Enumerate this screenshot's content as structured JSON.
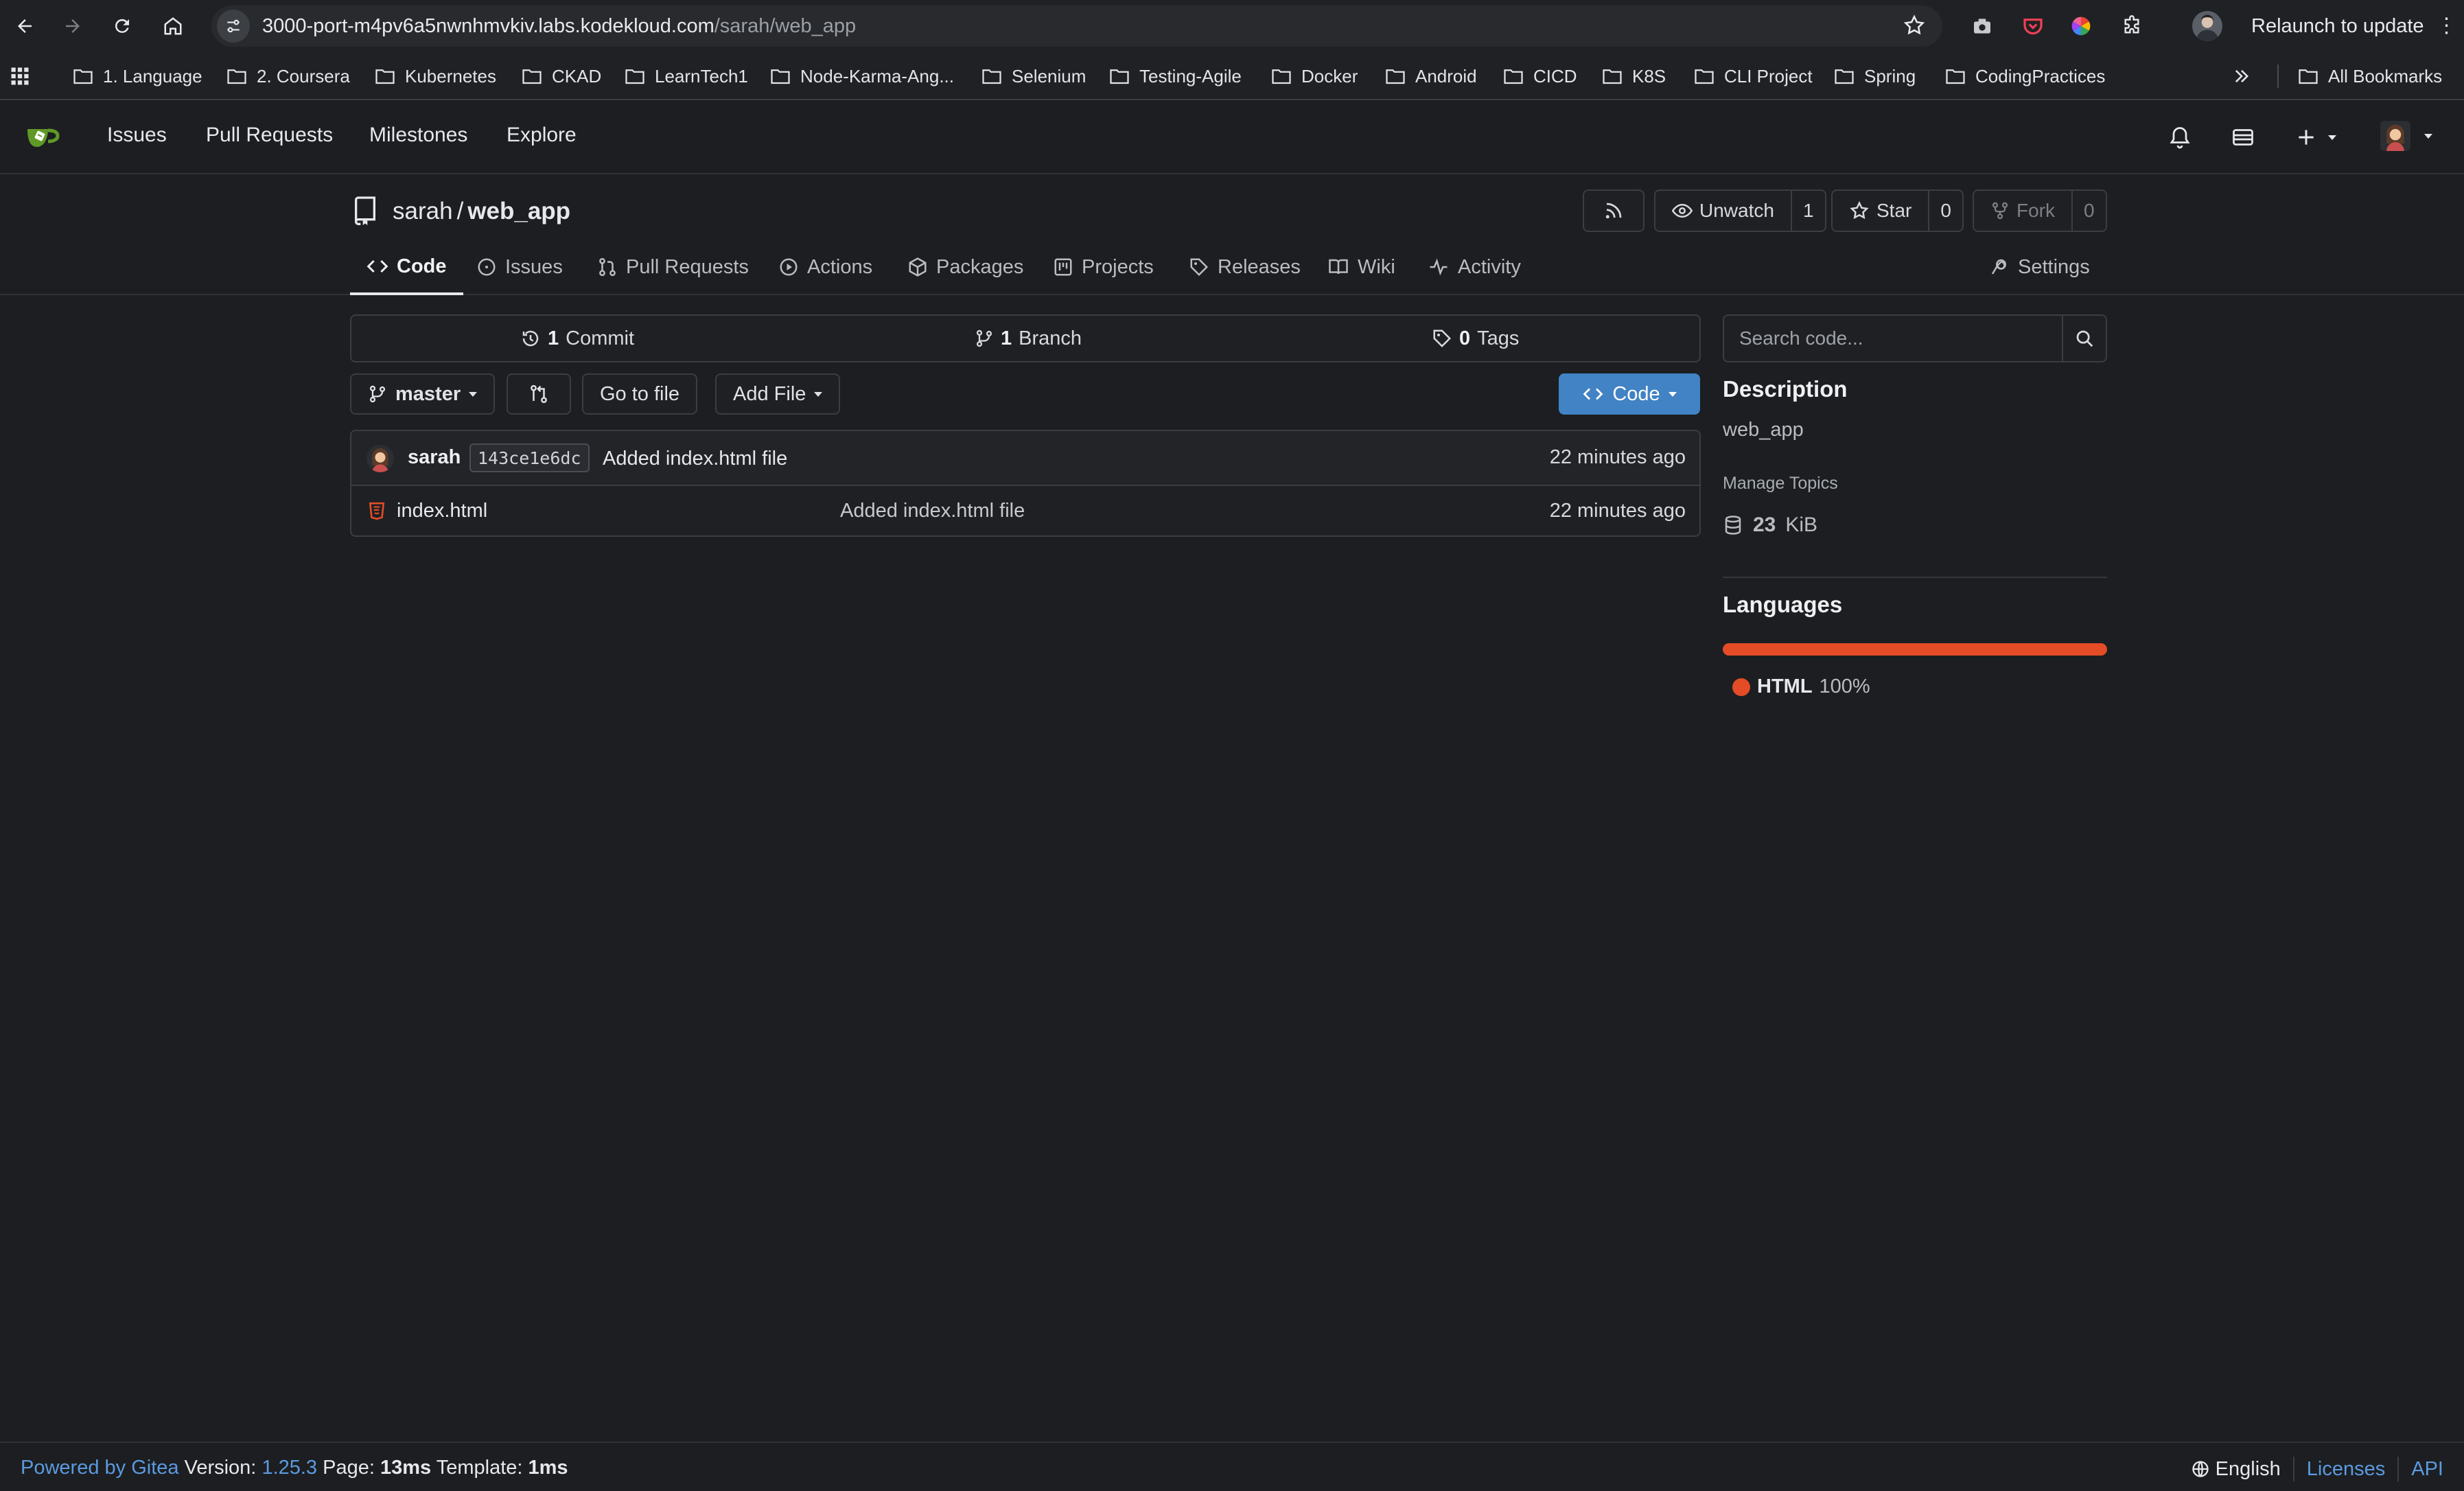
{
  "browser": {
    "url_host": "3000-port-m4pv6a5nwnhmvkiv.labs.kodekloud.com",
    "url_path": "/sarah/web_app",
    "relaunch_label": "Relaunch to update",
    "bookmarks": [
      "1. Language",
      "2. Coursera",
      "Kubernetes",
      "CKAD",
      "LearnTech1",
      "Node-Karma-Ang...",
      "Selenium",
      "Testing-Agile",
      "Docker",
      "Android",
      "CICD",
      "K8S",
      "CLI Project",
      "Spring",
      "CodingPractices"
    ],
    "all_bookmarks": "All Bookmarks"
  },
  "gitea_nav": {
    "issues": "Issues",
    "pull_requests": "Pull Requests",
    "milestones": "Milestones",
    "explore": "Explore"
  },
  "repo": {
    "owner": "sarah",
    "separator": "/",
    "name": "web_app",
    "unwatch_label": "Unwatch",
    "watch_count": "1",
    "star_label": "Star",
    "star_count": "0",
    "fork_label": "Fork",
    "fork_count": "0"
  },
  "tabs": {
    "code": "Code",
    "issues": "Issues",
    "pull_requests": "Pull Requests",
    "actions": "Actions",
    "packages": "Packages",
    "projects": "Projects",
    "releases": "Releases",
    "wiki": "Wiki",
    "activity": "Activity",
    "settings": "Settings"
  },
  "stats": {
    "commits_count": "1",
    "commits_label": "Commit",
    "branches_count": "1",
    "branches_label": "Branch",
    "tags_count": "0",
    "tags_label": "Tags"
  },
  "toolbar": {
    "branch": "master",
    "go_to_file": "Go to file",
    "add_file": "Add File",
    "code": "Code"
  },
  "latest_commit": {
    "author": "sarah",
    "sha": "143ce1e6dc",
    "message": "Added index.html file",
    "time": "22 minutes ago"
  },
  "files": [
    {
      "name": "index.html",
      "message": "Added index.html file",
      "time": "22 minutes ago"
    }
  ],
  "sidebar": {
    "search_placeholder": "Search code...",
    "description_heading": "Description",
    "description": "web_app",
    "manage_topics": "Manage Topics",
    "size_value": "23",
    "size_unit": "KiB",
    "languages_heading": "Languages",
    "languages": [
      {
        "name": "HTML",
        "percent": "100%",
        "share": 1.0,
        "color": "#e34c26"
      }
    ]
  },
  "footer": {
    "powered_by": "Powered by Gitea",
    "version_label": "Version:",
    "version": "1.25.3",
    "page_label": "Page:",
    "page_time": "13ms",
    "template_label": "Template:",
    "template_time": "1ms",
    "language": "English",
    "licenses": "Licenses",
    "api": "API"
  },
  "colors": {
    "accent": "#4183c4",
    "link": "#5c9ae0",
    "html_language": "#e34c26",
    "background": "#1c1e21"
  }
}
